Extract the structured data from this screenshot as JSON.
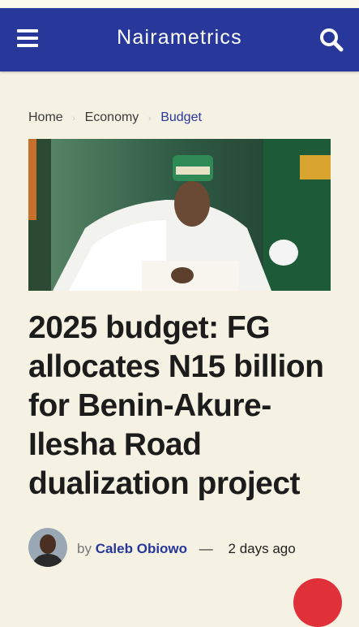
{
  "header": {
    "logo": "Nairametrics",
    "menu_icon": "hamburger-menu-icon",
    "search_icon": "search-icon",
    "bar_color": "#27379a"
  },
  "breadcrumb": [
    {
      "label": "Home"
    },
    {
      "label": "Economy"
    },
    {
      "label": "Budget"
    }
  ],
  "article": {
    "headline": "2025 budget: FG allocates N15 billion for Benin-Akure-Ilesha Road dualization project",
    "author_prefix": "by",
    "author": "Caleb Obiowo",
    "dash": "—",
    "date": "2 days ago"
  }
}
